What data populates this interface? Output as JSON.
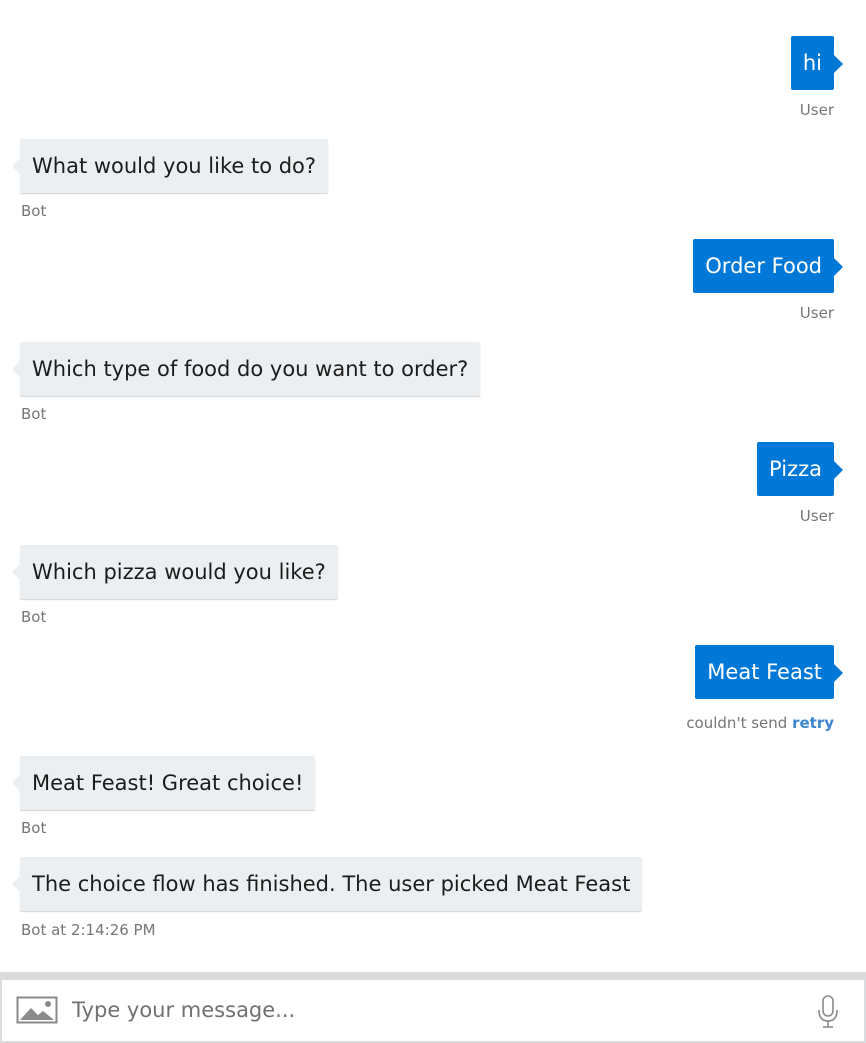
{
  "messages": [
    {
      "from": "user",
      "text": "hi",
      "meta": "User"
    },
    {
      "from": "bot",
      "text": "What would you like to do?",
      "meta": "Bot"
    },
    {
      "from": "user",
      "text": "Order Food",
      "meta": "User"
    },
    {
      "from": "bot",
      "text": "Which type of food do you want to order?",
      "meta": "Bot"
    },
    {
      "from": "user",
      "text": "Pizza",
      "meta": "User"
    },
    {
      "from": "bot",
      "text": "Which pizza would you like?",
      "meta": "Bot"
    },
    {
      "from": "user",
      "text": "Meat Feast",
      "status": "couldn't send",
      "retry_label": "retry"
    },
    {
      "from": "bot",
      "text": "Meat Feast! Great choice!",
      "meta": "Bot"
    },
    {
      "from": "bot",
      "text": "The choice flow has finished. The user picked Meat Feast",
      "meta": "Bot at 2:14:26 PM"
    }
  ],
  "composer": {
    "placeholder": "Type your message...",
    "upload_icon": "image-icon",
    "mic_icon": "microphone-icon"
  },
  "colors": {
    "user_bubble": "#0078d7",
    "bot_bubble": "#eceff1",
    "retry_link": "#3a86d0",
    "meta_text": "#767676"
  }
}
